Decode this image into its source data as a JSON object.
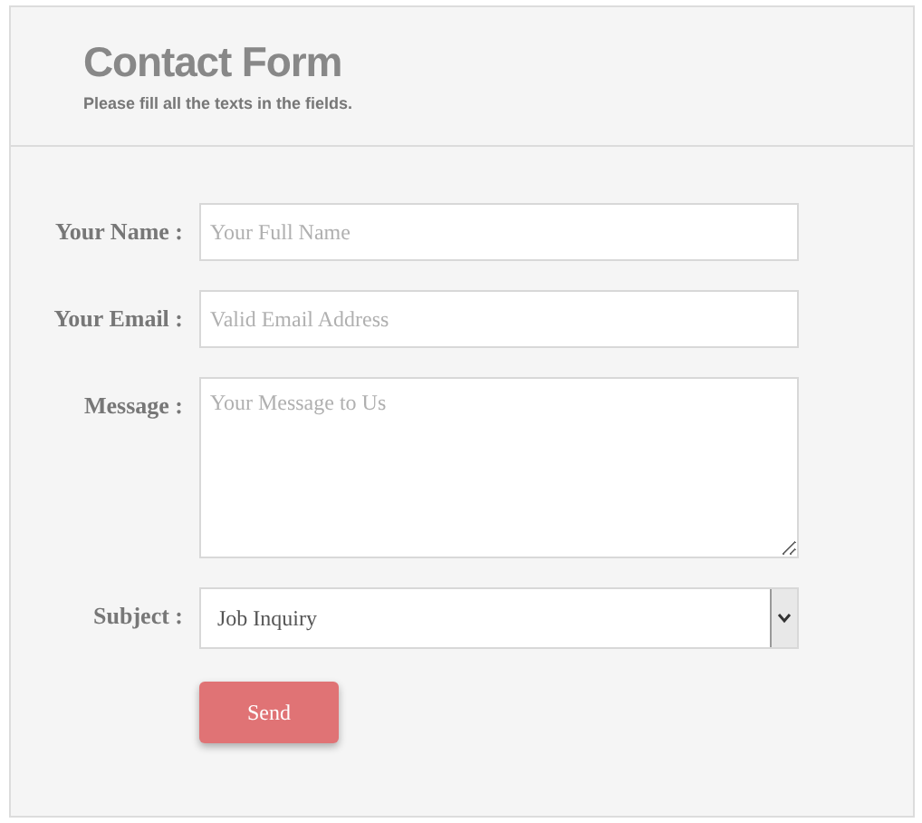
{
  "header": {
    "title": "Contact Form",
    "subtitle": "Please fill all the texts in the fields."
  },
  "fields": [
    {
      "kind": "input",
      "label": "Your Name :",
      "placeholder": "Your Full Name"
    },
    {
      "kind": "input",
      "label": "Your Email :",
      "placeholder": "Valid Email Address"
    },
    {
      "kind": "textarea",
      "label": "Message :",
      "placeholder": "Your Message to Us"
    },
    {
      "kind": "select",
      "label": "Subject :",
      "value": "Job Inquiry"
    }
  ],
  "submit": {
    "label": "Send"
  }
}
